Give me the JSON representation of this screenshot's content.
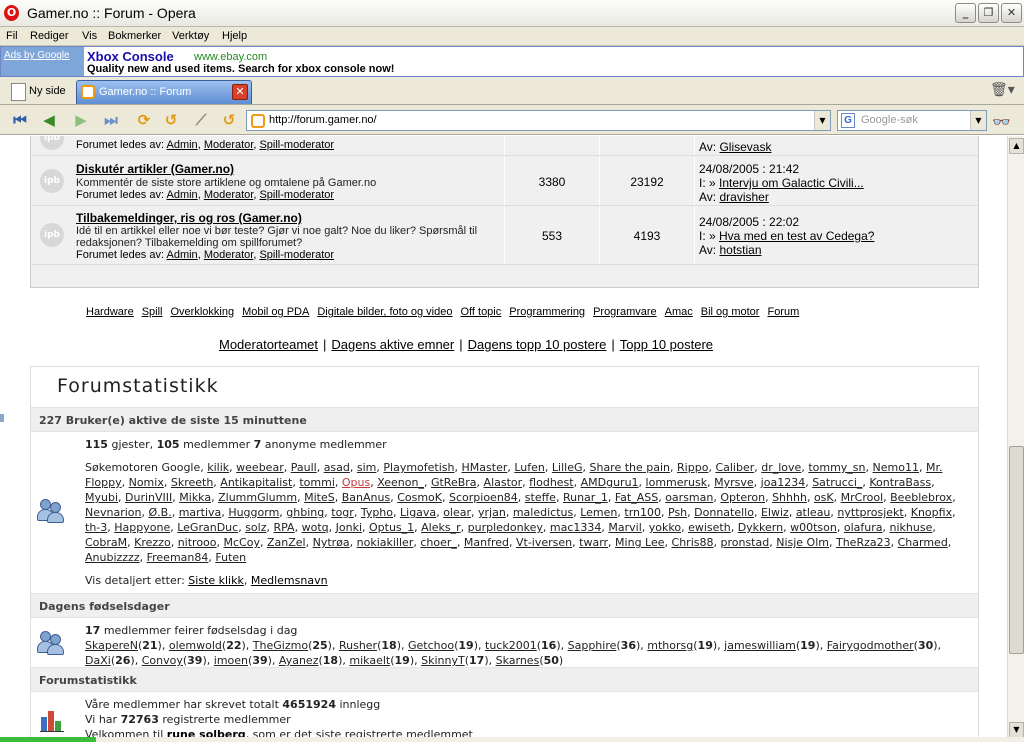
{
  "window": {
    "title": "Gamer.no :: Forum - Opera"
  },
  "menu": [
    "Fil",
    "Rediger",
    "Vis",
    "Bokmerker",
    "Verktøy",
    "Hjelp"
  ],
  "ad": {
    "ads_by": "Ads by Google",
    "title": "Xbox Console",
    "url": "www.ebay.com",
    "desc": "Quality new and used items. Search for xbox console now!"
  },
  "tabs": {
    "new_tab": "Ny side",
    "active": "Gamer.no :: Forum"
  },
  "address": {
    "url": "http://forum.gamer.no/",
    "search_placeholder": "Google-søk"
  },
  "forums": [
    {
      "name": "",
      "desc": "",
      "mods_prefix": "Forumet ledes av:",
      "mods": [
        "Admin",
        "Moderator",
        "Spill-moderator"
      ],
      "topics": "",
      "posts": "",
      "last_date": "",
      "last_title": "",
      "last_by_prefix": "Av:",
      "last_by": "Glisevask"
    },
    {
      "name": "Diskutér artikler (Gamer.no)",
      "desc": "Kommentér de siste store artiklene og omtalene på Gamer.no",
      "mods_prefix": "Forumet ledes av:",
      "mods": [
        "Admin",
        "Moderator",
        "Spill-moderator"
      ],
      "topics": "3380",
      "posts": "23192",
      "last_date": "24/08/2005 : 21:42",
      "last_title": "Intervju om Galactic Civili...",
      "last_by_prefix": "Av:",
      "last_by": "dravisher"
    },
    {
      "name": "Tilbakemeldinger, ris og ros (Gamer.no)",
      "desc": "Idé til en artikkel eller noe vi bør teste? Gjør vi noe galt? Noe du liker? Spørsmål til redaksjonen? Tilbakemelding om spillforumet?",
      "mods_prefix": "Forumet ledes av:",
      "mods": [
        "Admin",
        "Moderator",
        "Spill-moderator"
      ],
      "topics": "553",
      "posts": "4193",
      "last_date": "24/08/2005 : 22:02",
      "last_title": "Hva med en test av Cedega?",
      "last_by_prefix": "Av:",
      "last_by": "hotstian"
    }
  ],
  "icon_label": "ipb",
  "last_prefix": "I:",
  "categories": [
    "Hardware",
    "Spill",
    "Overklokking",
    "Mobil og PDA",
    "Digitale bilder, foto og video",
    "Off topic",
    "Programmering",
    "Programvare",
    "Amac",
    "Bil og motor",
    "Forum"
  ],
  "modlinks": [
    "Moderatorteamet",
    "Dagens aktive emner",
    "Dagens topp 10 postere",
    "Topp 10 postere"
  ],
  "stats": {
    "title": "Forumstatistikk",
    "active_header": "227 Bruker(e) aktive de siste 15 minuttene",
    "guests": "115",
    "guests_label": "gjester,",
    "members": "105",
    "members_label": "medlemmer",
    "anon": "7",
    "anon_label": "anonyme medlemmer",
    "active_users_prefix": "Søkemotoren Google,",
    "active_users": [
      "kilik",
      "weebear",
      "Paull",
      "asad",
      "sim",
      "Playmofetish",
      "HMaster",
      "Lufen",
      "LilleG",
      "Share the pain",
      "Rippo",
      "Caliber",
      "dr_love",
      "tommy_sn",
      "Nemo11",
      "Mr. Floppy",
      "Nomix",
      "Skreeth",
      "Antikapitalist",
      "tommi",
      "Opus",
      "Xeenon_",
      "GtReBra",
      "Alastor",
      "flodhest",
      "AMDguru1",
      "lommerusk",
      "Myrsve",
      "joa1234",
      "Satrucci_",
      "KontraBass",
      "Myubi",
      "DurinVIII",
      "Mikka",
      "ZlummGlumm",
      "MiteS",
      "BanAnus",
      "CosmoK",
      "Scorpioen84",
      "steffe",
      "Runar_1",
      "Fat_ASS",
      "oarsman",
      "Opteron",
      "Shhhh",
      "osK",
      "MrCrool",
      "Beeblebrox",
      "Nevnarion",
      "Ø.B.",
      "martiva",
      "Huggorm",
      "ghbing",
      "togr",
      "Typho",
      "Ligava",
      "olear",
      "yrjan",
      "maledictus",
      "Lemen",
      "trn100",
      "Psh",
      "Donnatello",
      "Elwiz",
      "atleau",
      "nyttprosjekt",
      "Knopfix",
      "th-3",
      "Happyone",
      "LeGranDuc",
      "solz",
      "RPA",
      "wotq",
      "Jonki",
      "Optus_1",
      "Aleks_r",
      "purpledonkey",
      "mac1334",
      "Marvil",
      "yokko",
      "ewiseth",
      "Dykkern",
      "w00tson",
      "olafura",
      "nikhuse",
      "CobraM",
      "Krezzo",
      "nitrooo",
      "McCoy",
      "ZanZel",
      "Nytrøa",
      "nokiakiller",
      "choer_",
      "Manfred",
      "Vt-iversen",
      "twarr",
      "Ming Lee",
      "Chris88",
      "pronstad",
      "Nisje Olm",
      "TheRza23",
      "Charmed",
      "Anubizzzz",
      "Freeman84",
      "Futen"
    ],
    "highlight_user": "Opus",
    "sort_prefix": "Vis detaljert etter:",
    "sort_links": [
      "Siste klikk",
      "Medlemsnavn"
    ],
    "birthday_header": "Dagens fødselsdager",
    "birthday_count": "17",
    "birthday_text": "medlemmer feirer fødselsdag i dag",
    "birthdays": [
      {
        "name": "SkapereN",
        "age": "21"
      },
      {
        "name": "olemwold",
        "age": "22"
      },
      {
        "name": "TheGizmo",
        "age": "25"
      },
      {
        "name": "Rusher",
        "age": "18"
      },
      {
        "name": "Getchoo",
        "age": "19"
      },
      {
        "name": "tuck2001",
        "age": "16"
      },
      {
        "name": "Sapphire",
        "age": "36"
      },
      {
        "name": "mthorsg",
        "age": "19"
      },
      {
        "name": "jameswilliam",
        "age": "19"
      },
      {
        "name": "Fairygodmother",
        "age": "30"
      },
      {
        "name": "DaXi",
        "age": "26"
      },
      {
        "name": "Convoy",
        "age": "39"
      },
      {
        "name": "imoen",
        "age": "39"
      },
      {
        "name": "Ayanez",
        "age": "18"
      },
      {
        "name": "mikaelt",
        "age": "19"
      },
      {
        "name": "SkinnyT",
        "age": "17"
      },
      {
        "name": "Skarnes",
        "age": "50"
      }
    ],
    "totals_header": "Forumstatistikk",
    "posts_prefix": "Våre medlemmer har skrevet totalt",
    "posts_total": "4651924",
    "posts_suffix": "innlegg",
    "members_prefix": "Vi har",
    "members_total": "72763",
    "members_suffix": "registrerte medlemmer",
    "newest_prefix": "Velkommen til",
    "newest_member": "rune solberg",
    "newest_suffix": ", som er det siste registrerte medlemmet"
  }
}
